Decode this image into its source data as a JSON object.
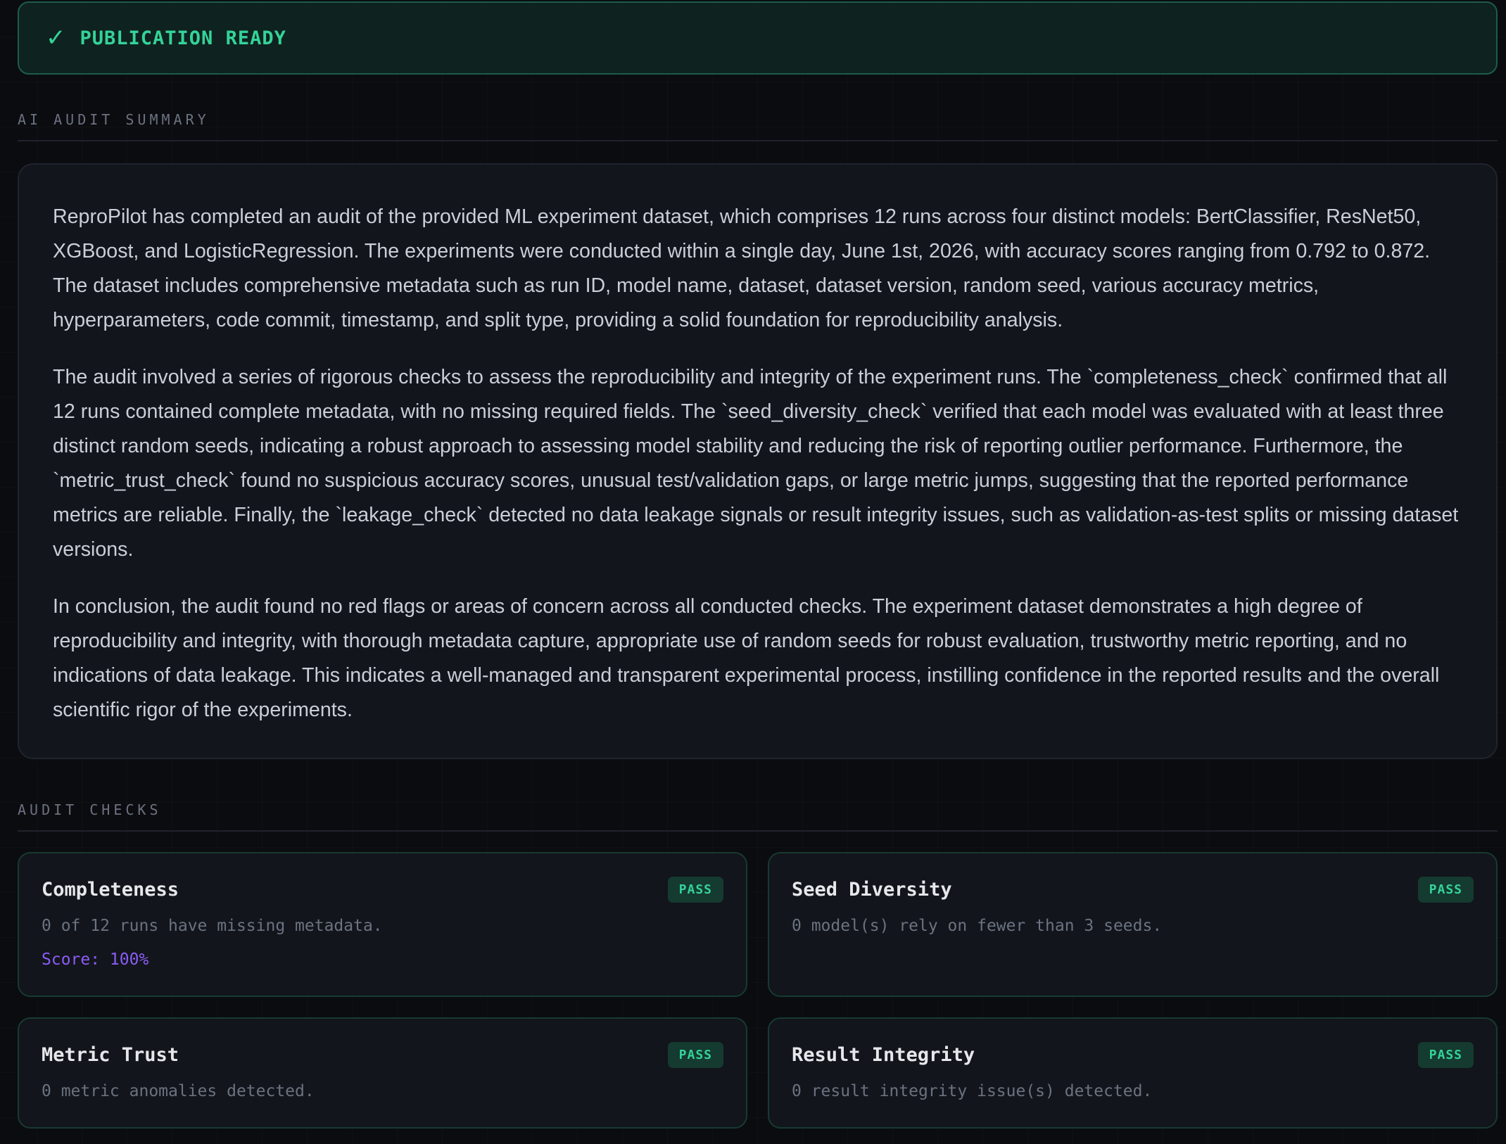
{
  "banner": {
    "icon": "check-icon",
    "check_glyph": "✓",
    "label": "PUBLICATION READY",
    "color": "#34d399"
  },
  "summary_section": {
    "title": "AI AUDIT SUMMARY",
    "paragraphs": [
      "ReproPilot has completed an audit of the provided ML experiment dataset, which comprises 12 runs across four distinct models: BertClassifier, ResNet50, XGBoost, and LogisticRegression. The experiments were conducted within a single day, June 1st, 2026, with accuracy scores ranging from 0.792 to 0.872. The dataset includes comprehensive metadata such as run ID, model name, dataset, dataset version, random seed, various accuracy metrics, hyperparameters, code commit, timestamp, and split type, providing a solid foundation for reproducibility analysis.",
      "The audit involved a series of rigorous checks to assess the reproducibility and integrity of the experiment runs. The `completeness_check` confirmed that all 12 runs contained complete metadata, with no missing required fields. The `seed_diversity_check` verified that each model was evaluated with at least three distinct random seeds, indicating a robust approach to assessing model stability and reducing the risk of reporting outlier performance. Furthermore, the `metric_trust_check` found no suspicious accuracy scores, unusual test/validation gaps, or large metric jumps, suggesting that the reported performance metrics are reliable. Finally, the `leakage_check` detected no data leakage signals or result integrity issues, such as validation-as-test splits or missing dataset versions.",
      "In conclusion, the audit found no red flags or areas of concern across all conducted checks. The experiment dataset demonstrates a high degree of reproducibility and integrity, with thorough metadata capture, appropriate use of random seeds for robust evaluation, trustworthy metric reporting, and no indications of data leakage. This indicates a well-managed and transparent experimental process, instilling confidence in the reported results and the overall scientific rigor of the experiments."
    ]
  },
  "checks_section": {
    "title": "AUDIT CHECKS",
    "checks": [
      {
        "name": "Completeness",
        "status": "PASS",
        "description": "0 of 12 runs have missing metadata.",
        "score": "Score: 100%"
      },
      {
        "name": "Seed Diversity",
        "status": "PASS",
        "description": "0 model(s) rely on fewer than 3 seeds."
      },
      {
        "name": "Metric Trust",
        "status": "PASS",
        "description": "0 metric anomalies detected."
      },
      {
        "name": "Result Integrity",
        "status": "PASS",
        "description": "0 result integrity issue(s) detected."
      }
    ]
  },
  "colors": {
    "pass": "#34d399",
    "score": "#8b5cf6",
    "background": "#0b0c10"
  }
}
